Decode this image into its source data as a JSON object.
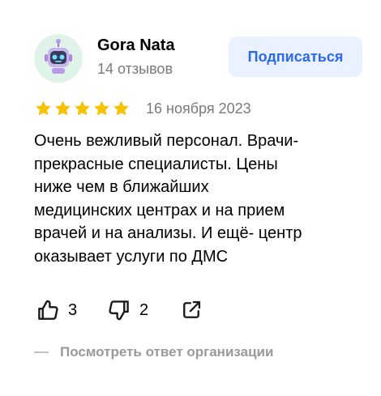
{
  "author": {
    "name": "Gora Nata",
    "reviews_count": "14 отзывов",
    "avatar_icon": "robot-icon",
    "avatar_bg": "#dff3e9"
  },
  "subscribe_button": {
    "label": "Подписаться",
    "color": "#2c68e8",
    "bg": "#eaf2ff"
  },
  "rating": {
    "stars": 5,
    "max": 5,
    "icon": "star-icon",
    "color": "#f7c200"
  },
  "date": "16 ноября 2023",
  "review_lines": [
    "Очень вежливый персонал. Врачи-",
    "прекрасные специалисты. Цены",
    "ниже чем в ближайших",
    "медицинских центрах и на прием",
    "врачей и на анализы. И ещё- центр",
    "оказывает услуги по ДМС"
  ],
  "actions": {
    "likes": "3",
    "dislikes": "2",
    "like_icon": "thumbs-up-icon",
    "dislike_icon": "thumbs-down-icon",
    "share_icon": "share-icon"
  },
  "org_answer_link": "Посмотреть ответ организации"
}
